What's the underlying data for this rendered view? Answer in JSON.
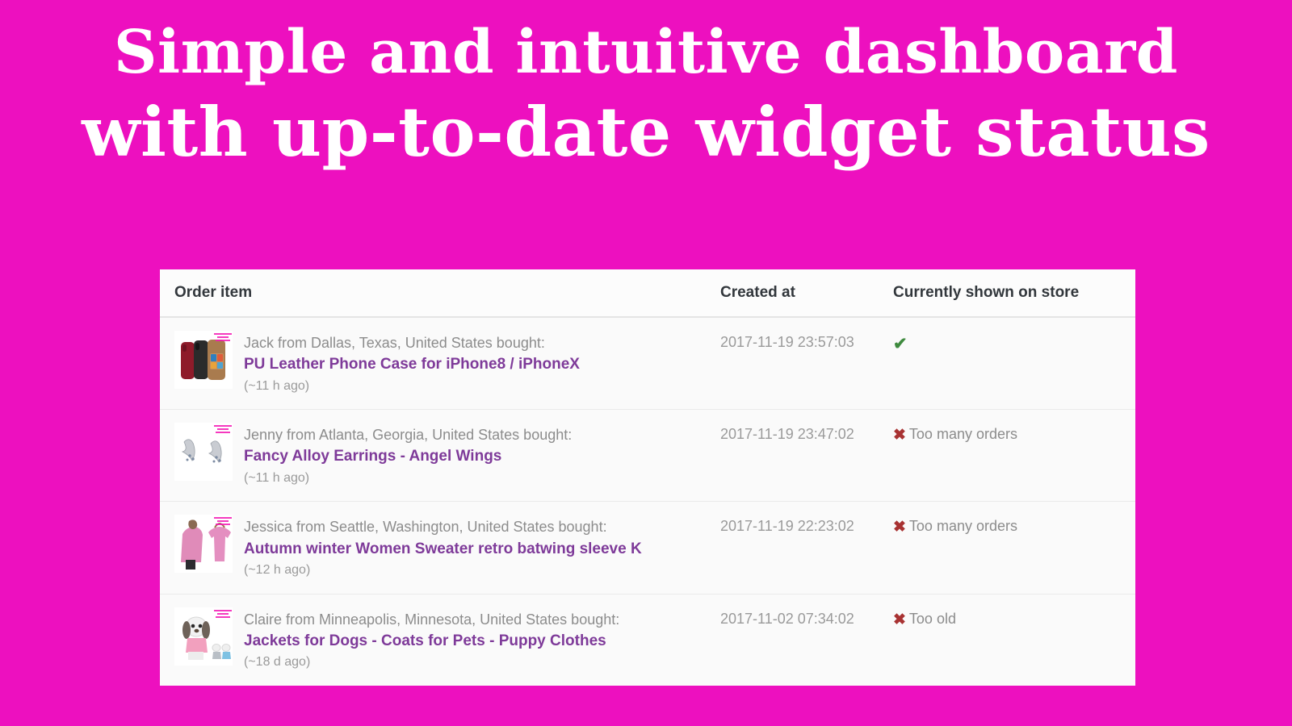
{
  "hero": {
    "line1": "Simple and intuitive dashboard",
    "line2": "with up-to-date widget status",
    "bg_color": "#ED10BF",
    "text_color": "#FFFFFF"
  },
  "colors": {
    "accent": "#ED10BF",
    "card_bg": "#FCFCFC",
    "row_bg": "#FAFAFA",
    "product_link": "#7E3A99",
    "muted_text": "#8C8C8C",
    "ok_green": "#3E8A3E",
    "bad_red": "#A83232"
  },
  "table": {
    "headers": {
      "item": "Order item",
      "created_at": "Created at",
      "shown_on_store": "Currently shown on store"
    },
    "rows": [
      {
        "buyer": "Jack from Dallas, Texas, United States bought:",
        "product": "PU Leather Phone Case for iPhone8 / iPhoneX",
        "ago": "(~11 h ago)",
        "created_at": "2017-11-19 23:57:03",
        "status_mark": "✔",
        "status_label": "",
        "status_state": "ok",
        "thumb": "phone-case-thumbnail"
      },
      {
        "buyer": "Jenny from Atlanta, Georgia, United States bought:",
        "product": "Fancy Alloy Earrings - Angel Wings",
        "ago": "(~11 h ago)",
        "created_at": "2017-11-19 23:47:02",
        "status_mark": "✖",
        "status_label": "Too many orders",
        "status_state": "bad",
        "thumb": "earrings-thumbnail"
      },
      {
        "buyer": "Jessica from Seattle, Washington, United States bought:",
        "product": "Autumn winter Women Sweater retro batwing sleeve K",
        "ago": "(~12 h ago)",
        "created_at": "2017-11-19 22:23:02",
        "status_mark": "✖",
        "status_label": "Too many orders",
        "status_state": "bad",
        "thumb": "sweater-thumbnail"
      },
      {
        "buyer": "Claire from Minneapolis, Minnesota, United States bought:",
        "product": "Jackets for Dogs - Coats for Pets - Puppy Clothes",
        "ago": "(~18 d ago)",
        "created_at": "2017-11-02 07:34:02",
        "status_mark": "✖",
        "status_label": "Too old",
        "status_state": "bad",
        "thumb": "dog-clothes-thumbnail"
      }
    ]
  }
}
